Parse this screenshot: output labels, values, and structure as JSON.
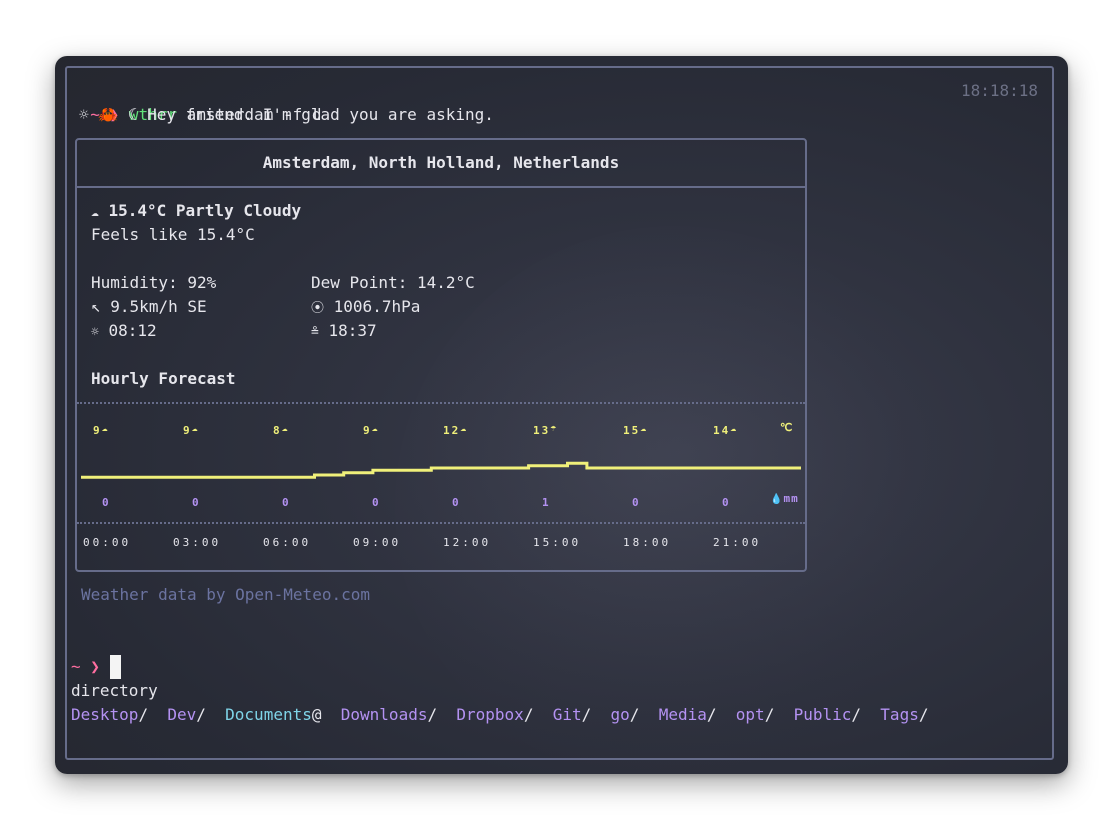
{
  "prompt": {
    "symbol": "~ ❯",
    "command": "wthrr",
    "args": "amsterdam -f d",
    "clock": "18:18:18"
  },
  "greeting": {
    "icons": "☼ 🦀 ☾",
    "text": "Hey friend. I'm glad you are asking."
  },
  "weather": {
    "location": "Amsterdam, North Holland, Netherlands",
    "current_icon": "☁",
    "current": "15.4°C Partly Cloudy",
    "feels_like": "Feels like 15.4°C",
    "humidity": "Humidity: 92%",
    "dew_point": "Dew Point: 14.2°C",
    "wind_icon": "↖",
    "wind": "9.5km/h SE",
    "pressure_icon": "⦿",
    "pressure": "1006.7hPa",
    "sunrise_icon": "☼",
    "sunrise": "08:12",
    "sunset_icon": "≗",
    "sunset": "18:37",
    "hourly_title": "Hourly Forecast",
    "temp_unit": "℃",
    "rain_unit": "mm",
    "rain_icon": "💧",
    "hourly": [
      {
        "time": "00:00",
        "temp": "9",
        "icon": "☁",
        "rain": "0"
      },
      {
        "time": "03:00",
        "temp": "9",
        "icon": "☁",
        "rain": "0"
      },
      {
        "time": "06:00",
        "temp": "8",
        "icon": "☁",
        "rain": "0"
      },
      {
        "time": "09:00",
        "temp": "9",
        "icon": "☁",
        "rain": "0"
      },
      {
        "time": "12:00",
        "temp": "12",
        "icon": "☁",
        "rain": "0"
      },
      {
        "time": "15:00",
        "temp": "13",
        "icon": "☂",
        "rain": "1"
      },
      {
        "time": "18:00",
        "temp": "15",
        "icon": "☁",
        "rain": "0"
      },
      {
        "time": "21:00",
        "temp": "14",
        "icon": "☁",
        "rain": "0"
      }
    ],
    "graph_temps": [
      9,
      9,
      9,
      9,
      9,
      9,
      9,
      9,
      9,
      9,
      9,
      9,
      9,
      9,
      9,
      9,
      9,
      9,
      9,
      9,
      9,
      9,
      9,
      9,
      9.5,
      9.5,
      9.5,
      10,
      10,
      10,
      10.5,
      10.5,
      10.5,
      10.5,
      10.5,
      10.5,
      11,
      11,
      11,
      11,
      11,
      11,
      11,
      11,
      11,
      11,
      11.5,
      11.5,
      11.5,
      11.5,
      12,
      12,
      11,
      11,
      11,
      11,
      11,
      11,
      11,
      11,
      11,
      11,
      11,
      11,
      11,
      11,
      11,
      11,
      11,
      11,
      11,
      11,
      11,
      11
    ],
    "credit": "Weather data by Open-Meteo.com"
  },
  "prompt2": {
    "symbol": "~ ❯"
  },
  "ls": {
    "label": "directory",
    "entries": [
      {
        "name": "Desktop",
        "suffix": "/",
        "color": "purple"
      },
      {
        "name": "Dev",
        "suffix": "/",
        "color": "purple"
      },
      {
        "name": "Documents",
        "suffix": "@",
        "color": "cyan"
      },
      {
        "name": "Downloads",
        "suffix": "/",
        "color": "purple"
      },
      {
        "name": "Dropbox",
        "suffix": "/",
        "color": "purple"
      },
      {
        "name": "Git",
        "suffix": "/",
        "color": "purple"
      },
      {
        "name": "go",
        "suffix": "/",
        "color": "purple"
      },
      {
        "name": "Media",
        "suffix": "/",
        "color": "purple"
      },
      {
        "name": "opt",
        "suffix": "/",
        "color": "purple"
      },
      {
        "name": "Public",
        "suffix": "/",
        "color": "purple"
      },
      {
        "name": "Tags",
        "suffix": "/",
        "color": "purple"
      }
    ]
  }
}
